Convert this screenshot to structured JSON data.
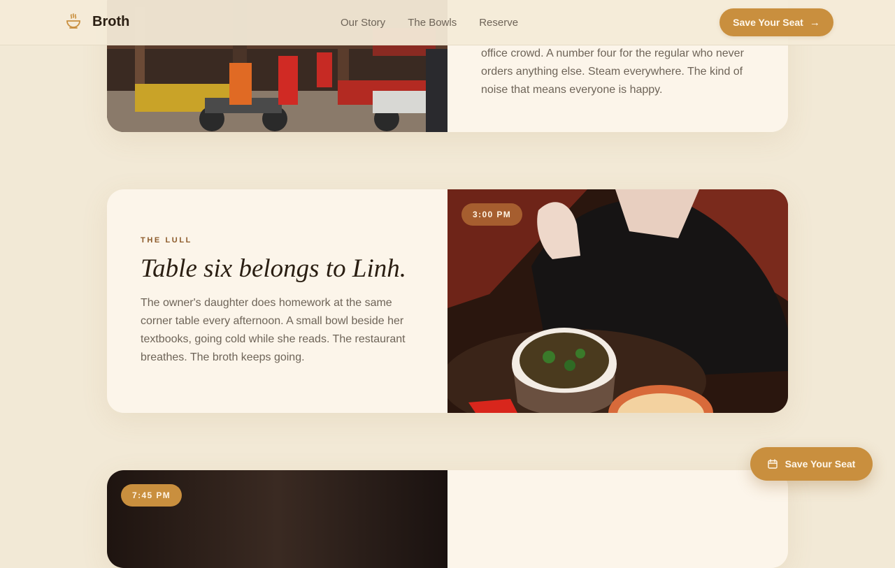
{
  "header": {
    "brand_name": "Broth",
    "brand_icon": "steaming-bowl-icon",
    "nav": [
      {
        "label": "Our Story"
      },
      {
        "label": "The Bowls"
      },
      {
        "label": "Reserve"
      }
    ],
    "cta_label": "Save Your Seat",
    "cta_icon": "arrow-right-icon"
  },
  "sections": [
    {
      "photo_subject": "street-food-stall-photo",
      "body": "office crowd. A number four for the regular who never orders anything else. Steam everywhere. The kind of noise that means everyone is happy."
    },
    {
      "time_badge": "3:00 PM",
      "eyebrow": "THE LULL",
      "headline": "Table six belongs to Linh.",
      "body": "The owner's daughter does homework at the same corner table every afternoon. A small bowl beside her textbooks, going cold while she reads. The restaurant breathes. The broth keeps going.",
      "photo_subject": "pho-bowl-on-table-photo"
    },
    {
      "time_badge": "7:45 PM",
      "photo_subject": "evening-dining-photo"
    }
  ],
  "floating_cta": {
    "label": "Save Your Seat",
    "icon": "calendar-icon"
  },
  "colors": {
    "background": "#f2e9d6",
    "card": "#fcf5ea",
    "accent_gold": "#c98f3e",
    "badge_rust": "#a65e2f",
    "text_dark": "#2a1e12",
    "text_muted": "#6e6458",
    "eyebrow": "#8c5a2a"
  }
}
